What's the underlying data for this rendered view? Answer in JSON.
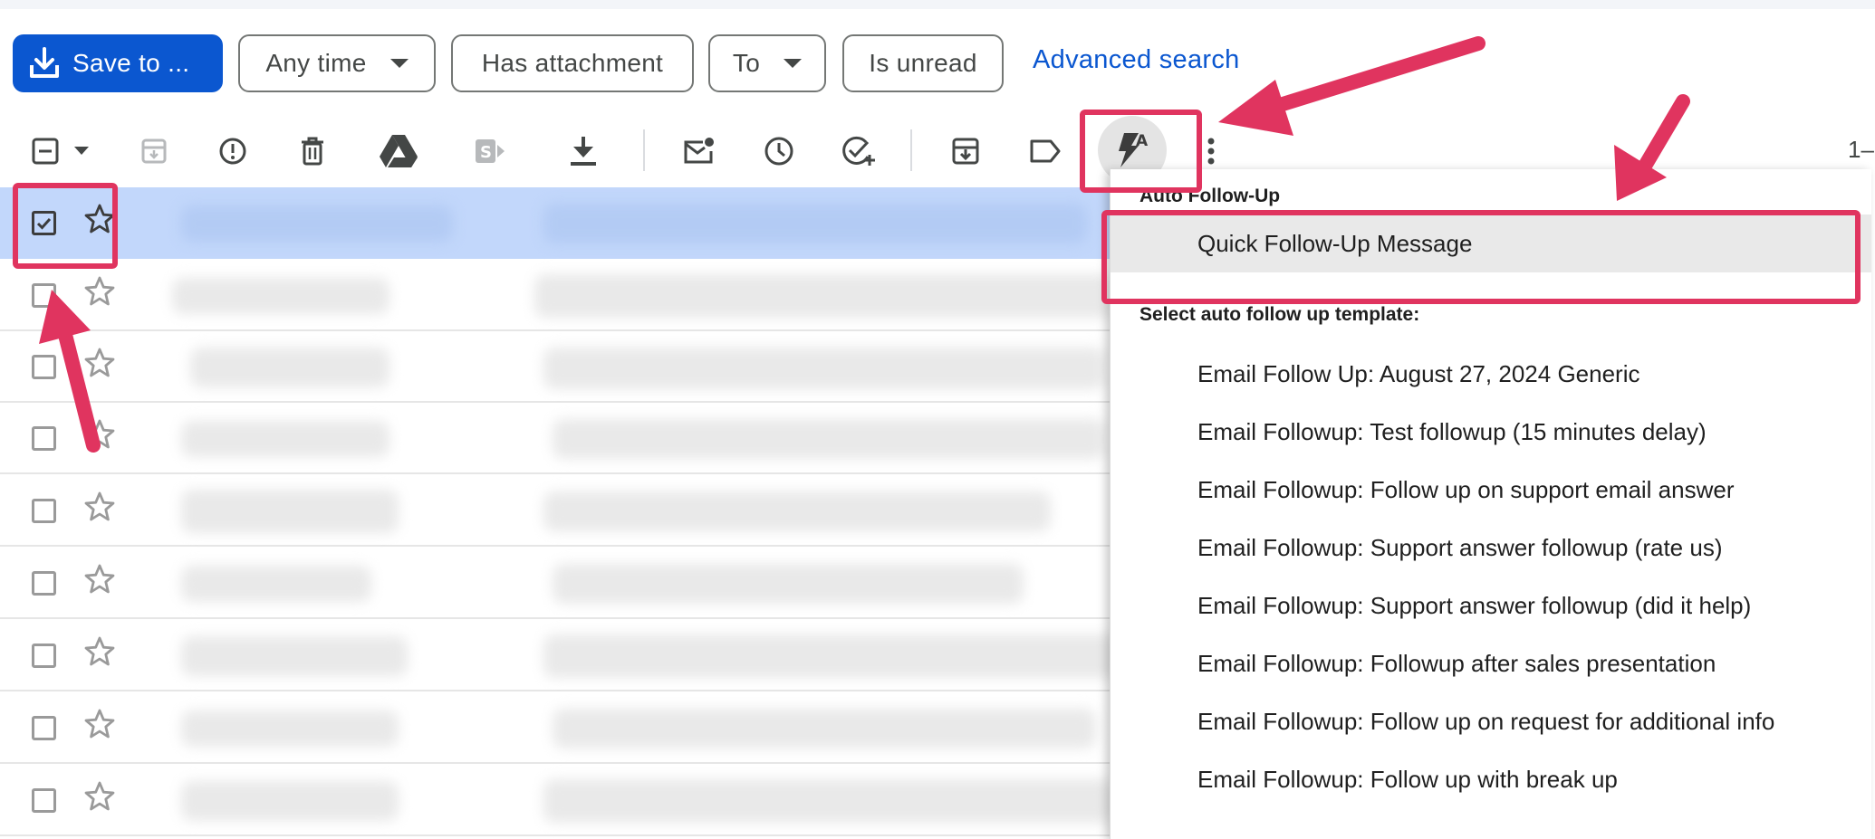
{
  "filters": {
    "save_label": "Save to ...",
    "chips": [
      {
        "label": "Any time",
        "has_caret": true
      },
      {
        "label": "Has attachment",
        "has_caret": false
      },
      {
        "label": "To",
        "has_caret": true
      },
      {
        "label": "Is unread",
        "has_caret": false
      }
    ],
    "advanced_search_label": "Advanced search"
  },
  "toolbar": {
    "buttons": [
      {
        "name": "select-all-checkbox",
        "icon": "minus-checkbox-icon"
      },
      {
        "name": "select-dropdown",
        "icon": "caret-down-icon"
      },
      {
        "name": "archive-button",
        "icon": "archive-icon"
      },
      {
        "name": "report-spam-button",
        "icon": "report-spam-icon"
      },
      {
        "name": "delete-button",
        "icon": "trash-icon"
      },
      {
        "name": "save-to-drive-button",
        "icon": "google-drive-icon"
      },
      {
        "name": "sharepoint-button",
        "icon": "sharepoint-icon"
      },
      {
        "name": "download-button",
        "icon": "download-icon"
      },
      {
        "name": "mark-unread-button",
        "icon": "mark-unread-icon"
      },
      {
        "name": "snooze-button",
        "icon": "clock-icon"
      },
      {
        "name": "add-to-tasks-button",
        "icon": "add-task-icon"
      },
      {
        "name": "move-to-button",
        "icon": "move-to-icon"
      },
      {
        "name": "labels-button",
        "icon": "label-icon"
      },
      {
        "name": "auto-follow-up-button",
        "icon": "auto-follow-up-icon"
      },
      {
        "name": "more-options-button",
        "icon": "more-vert-icon"
      }
    ],
    "pagination_text": "1–"
  },
  "email_rows": [
    {
      "selected": true,
      "starred": false
    },
    {
      "selected": false,
      "starred": false
    },
    {
      "selected": false,
      "starred": false
    },
    {
      "selected": false,
      "starred": false
    },
    {
      "selected": false,
      "starred": false
    },
    {
      "selected": false,
      "starred": false
    },
    {
      "selected": false,
      "starred": false
    },
    {
      "selected": false,
      "starred": false
    },
    {
      "selected": false,
      "starred": false
    }
  ],
  "dropdown": {
    "section1_header": "Auto Follow-Up",
    "quick_item": "Quick Follow-Up Message",
    "section2_header": "Select auto follow up template:",
    "templates": [
      "Email Follow Up: August 27, 2024 Generic",
      "Email Followup: Test followup (15 minutes delay)",
      "Email Followup: Follow up on support email answer",
      "Email Followup: Support answer followup (rate us)",
      "Email Followup: Support answer followup (did it help)",
      "Email Followup: Followup after sales presentation",
      "Email Followup: Follow up on request for additional info",
      "Email Followup: Follow up with break up"
    ]
  },
  "colors": {
    "primary_blue": "#0b57d0",
    "selected_row": "#c2d7fb",
    "annotation_pink": "#e0345f",
    "menu_highlight": "#e9e9e9"
  }
}
